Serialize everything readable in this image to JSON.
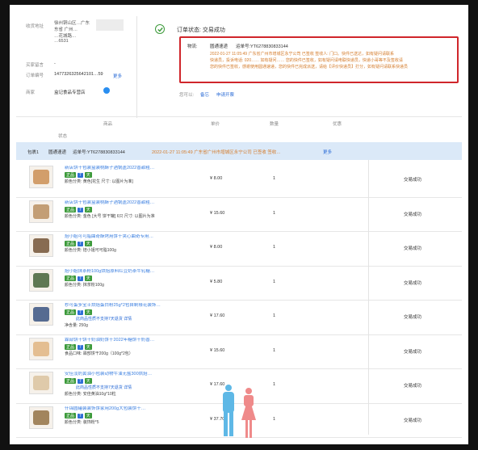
{
  "info": {
    "address_label": "收货地址",
    "address_text": [
      "徐州铜山区…广东",
      "东省 广州…",
      "…花城路…",
      "…6531"
    ],
    "buyer_label": "买家留言",
    "buyer_value": "-",
    "order_label": "订单编号",
    "order_value": "1477326325642101…59",
    "more": "更多",
    "seller_label": "商家",
    "seller_value": "盒记食品专营店"
  },
  "status": {
    "title": "订单状态: 交易成功",
    "log_label": "物流:",
    "carrier": "圆通速递",
    "tracking": "运单号:YT6278830833144",
    "line1": "2022-01-27 11:05:49  广东省广州市增城区永宁公司 已签收 签收人: 门口。快件已送达，如有疑问请联系",
    "line2": "快递员，投诉电话: 020…… 如有疑问…… 您的快件已签收，如有疑问请电联快递员，快递小哥等不及签收请",
    "line3": "您的快件已签收，感谢使用圆通速递，您的快件已完成派送，请给【评价快递员】打分，如有疑问请联系快递员",
    "maybe_label": "您可以:",
    "action1": "备忘",
    "action2": "申请开票"
  },
  "table": {
    "headers": [
      "商品",
      "单价",
      "数量",
      "优惠",
      "状态"
    ]
  },
  "package": {
    "label": "包裹1",
    "carrier": "圆通速递",
    "tracking": "运单号:YT6278830833144",
    "event": "2022-01-27 11:05:49  广东省广州市增城区永宁公司 已签收 签收…",
    "more": "更多"
  },
  "products": [
    {
      "title": "新店饼干包装盒装桃酥子酒锅盖2022香甜粗…",
      "spec": "颜色分类: 黄色[花生 尺寸: 以图片为准]",
      "price": "¥ 8.00",
      "qty": "1",
      "status": "交易成功"
    },
    {
      "title": "新店饼干包装盒装桃酥子酒锅盖2022香甜粗…",
      "spec": "颜色分类: 金色 [大号 饼干罐] 6只 尺寸: 以图片为准",
      "price": "¥ 15.60",
      "qty": "1",
      "status": "交易成功"
    },
    {
      "title": "焙小姐可可脂曲奇酥烤用饼干夹心曲奇专用…",
      "spec": "颜色分类: 焙小姐可可脂100g",
      "price": "¥ 8.00",
      "qty": "1",
      "status": "交易成功"
    },
    {
      "title": "焙小姐抹茶粉100g烘焙原料红豆奶茶牛轧糖…",
      "spec": "颜色分类: 抹茶粉100g",
      "price": "¥ 5.80",
      "qty": "1",
      "status": "交易成功"
    },
    {
      "title": "秒可蛋多宝士烘焙蛋白粉25g*2包自制裱花装饰…",
      "spec": "净含量: 250g",
      "notice": "此商品性质不支持7天退货 详情",
      "price": "¥ 17.60",
      "qty": "1",
      "status": "交易成功"
    },
    {
      "title": "霖部饼干饼干奶油奶饼干2022年糖饼干奶香…",
      "spec": "食品口味: 霖部饼干200g（100g*2包）",
      "price": "¥ 15.60",
      "qty": "1",
      "status": "交易成功"
    },
    {
      "title": "安佳淡奶黄油小包装动物牛油无盐300烘焙…",
      "spec": "颜色分类: 安佳黄油10g*10粒",
      "notice": "此商品性质不支持7天退货 详情",
      "price": "¥ 17.60",
      "qty": "1",
      "status": "交易成功"
    },
    {
      "title": "什锦圆罐装装饰饼家用200g大包装饼干…",
      "spec": "颜色分类: 装饰粉*5",
      "price": "¥ 37.70",
      "qty": "1",
      "status": "交易成功"
    }
  ],
  "tags": {
    "t1": "正品",
    "t2": "7",
    "t3": "天"
  },
  "colors": {
    "accent_blue": "#2a6bd6",
    "success_green": "#3c9a3a",
    "highlight_red": "#d0262b",
    "header_bg": "#dbe9f8"
  }
}
